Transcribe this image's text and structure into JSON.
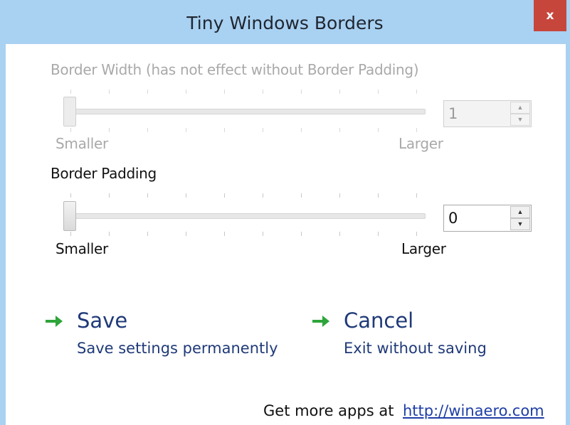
{
  "window": {
    "title": "Tiny Windows Borders",
    "close_label": "x"
  },
  "border_width": {
    "label": "Border Width (has not effect without Border Padding)",
    "min_label": "Smaller",
    "max_label": "Larger",
    "value": "1",
    "enabled": false
  },
  "border_padding": {
    "label": "Border Padding",
    "min_label": "Smaller",
    "max_label": "Larger",
    "value": "0",
    "enabled": true
  },
  "actions": {
    "save": {
      "title": "Save",
      "description": "Save settings permanently",
      "icon": "green-arrow-icon"
    },
    "cancel": {
      "title": "Cancel",
      "description": "Exit without saving",
      "icon": "green-arrow-icon"
    }
  },
  "footer": {
    "text": "Get more apps at",
    "link": "http://winaero.com"
  },
  "colors": {
    "titlebar": "#a9d1f2",
    "close": "#c7463c",
    "action_text": "#1f3a78",
    "arrow": "#2ea53a",
    "link": "#1e3ea7"
  }
}
